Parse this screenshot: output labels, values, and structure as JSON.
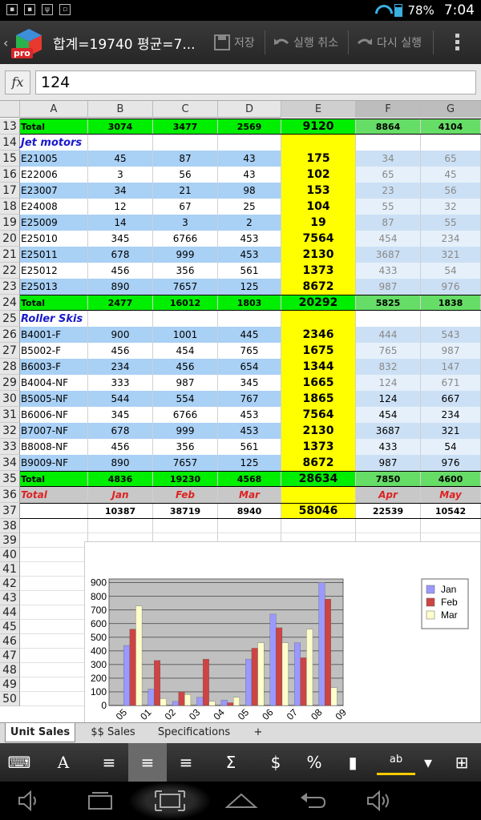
{
  "status": {
    "battery": "78%",
    "time": "7:04"
  },
  "actionbar": {
    "title": "합계=19740  평균=7...",
    "save": "저장",
    "undo": "실행 취소",
    "redo": "다시 실행",
    "logo_badge": "pro"
  },
  "formula": {
    "fx": "fx",
    "value": "124"
  },
  "columns": [
    "A",
    "B",
    "C",
    "D",
    "E",
    "F",
    "G"
  ],
  "rows": [
    {
      "n": "13",
      "cells": [
        "Total",
        "3074",
        "3477",
        "2569",
        "9120",
        "8864",
        "4104"
      ],
      "style": "total"
    },
    {
      "n": "14",
      "cells": [
        "Jet motors",
        "",
        "",
        "",
        "",
        "",
        ""
      ],
      "style": "section"
    },
    {
      "n": "15",
      "cells": [
        "E21005",
        "45",
        "87",
        "43",
        "175",
        "34",
        "65"
      ],
      "style": "blue"
    },
    {
      "n": "16",
      "cells": [
        "E22006",
        "3",
        "56",
        "43",
        "102",
        "65",
        "45"
      ],
      "style": "white"
    },
    {
      "n": "17",
      "cells": [
        "E23007",
        "34",
        "21",
        "98",
        "153",
        "23",
        "56"
      ],
      "style": "blue"
    },
    {
      "n": "18",
      "cells": [
        "E24008",
        "12",
        "67",
        "25",
        "104",
        "55",
        "32"
      ],
      "style": "white"
    },
    {
      "n": "19",
      "cells": [
        "E25009",
        "14",
        "3",
        "2",
        "19",
        "87",
        "55"
      ],
      "style": "blue"
    },
    {
      "n": "20",
      "cells": [
        "E25010",
        "345",
        "6766",
        "453",
        "7564",
        "454",
        "234"
      ],
      "style": "white"
    },
    {
      "n": "21",
      "cells": [
        "E25011",
        "678",
        "999",
        "453",
        "2130",
        "3687",
        "321"
      ],
      "style": "blue"
    },
    {
      "n": "22",
      "cells": [
        "E25012",
        "456",
        "356",
        "561",
        "1373",
        "433",
        "54"
      ],
      "style": "white"
    },
    {
      "n": "23",
      "cells": [
        "E25013",
        "890",
        "7657",
        "125",
        "8672",
        "987",
        "976"
      ],
      "style": "blue"
    },
    {
      "n": "24",
      "cells": [
        "Total",
        "2477",
        "16012",
        "1803",
        "20292",
        "5825",
        "1838"
      ],
      "style": "total"
    },
    {
      "n": "25",
      "cells": [
        "Roller Skis",
        "",
        "",
        "",
        "",
        "",
        ""
      ],
      "style": "section"
    },
    {
      "n": "26",
      "cells": [
        "B4001-F",
        "900",
        "1001",
        "445",
        "2346",
        "444",
        "543"
      ],
      "style": "blue"
    },
    {
      "n": "27",
      "cells": [
        "B5002-F",
        "456",
        "454",
        "765",
        "1675",
        "765",
        "987"
      ],
      "style": "white"
    },
    {
      "n": "28",
      "cells": [
        "B6003-F",
        "234",
        "456",
        "654",
        "1344",
        "832",
        "147"
      ],
      "style": "blue"
    },
    {
      "n": "29",
      "cells": [
        "B4004-NF",
        "333",
        "987",
        "345",
        "1665",
        "124",
        "671"
      ],
      "style": "white"
    },
    {
      "n": "30",
      "cells": [
        "B5005-NF",
        "544",
        "554",
        "767",
        "1865",
        "124",
        "667"
      ],
      "style": "blue"
    },
    {
      "n": "31",
      "cells": [
        "B6006-NF",
        "345",
        "6766",
        "453",
        "7564",
        "454",
        "234"
      ],
      "style": "white"
    },
    {
      "n": "32",
      "cells": [
        "B7007-NF",
        "678",
        "999",
        "453",
        "2130",
        "3687",
        "321"
      ],
      "style": "blue"
    },
    {
      "n": "33",
      "cells": [
        "B8008-NF",
        "456",
        "356",
        "561",
        "1373",
        "433",
        "54"
      ],
      "style": "white"
    },
    {
      "n": "34",
      "cells": [
        "B9009-NF",
        "890",
        "7657",
        "125",
        "8672",
        "987",
        "976"
      ],
      "style": "blue"
    },
    {
      "n": "35",
      "cells": [
        "Total",
        "4836",
        "19230",
        "4568",
        "28634",
        "7850",
        "4600"
      ],
      "style": "total"
    },
    {
      "n": "36",
      "cells": [
        "Total",
        "Jan",
        "Feb",
        "Mar",
        "",
        "Apr",
        "May"
      ],
      "style": "gray"
    },
    {
      "n": "37",
      "cells": [
        "",
        "10387",
        "38719",
        "8940",
        "58046",
        "22539",
        "10542"
      ],
      "style": "grand"
    },
    {
      "n": "38",
      "cells": [
        "",
        "",
        "",
        "",
        "",
        "",
        ""
      ],
      "style": "empty"
    },
    {
      "n": "39",
      "cells": [
        "",
        "",
        "",
        "",
        "",
        "",
        ""
      ],
      "style": "empty"
    },
    {
      "n": "40",
      "cells": [
        "",
        "",
        "",
        "",
        "",
        "",
        ""
      ],
      "style": "empty"
    },
    {
      "n": "41",
      "cells": [
        "",
        "",
        "",
        "",
        "",
        "",
        ""
      ],
      "style": "empty"
    },
    {
      "n": "42",
      "cells": [
        "",
        "",
        "",
        "",
        "",
        "",
        ""
      ],
      "style": "empty"
    },
    {
      "n": "43",
      "cells": [
        "",
        "",
        "",
        "",
        "",
        "",
        ""
      ],
      "style": "empty"
    },
    {
      "n": "44",
      "cells": [
        "",
        "",
        "",
        "",
        "",
        "",
        ""
      ],
      "style": "empty"
    },
    {
      "n": "45",
      "cells": [
        "",
        "",
        "",
        "",
        "",
        "",
        ""
      ],
      "style": "empty"
    },
    {
      "n": "46",
      "cells": [
        "",
        "",
        "",
        "",
        "",
        "",
        ""
      ],
      "style": "empty"
    },
    {
      "n": "47",
      "cells": [
        "",
        "",
        "",
        "",
        "",
        "",
        ""
      ],
      "style": "empty"
    },
    {
      "n": "48",
      "cells": [
        "",
        "",
        "",
        "",
        "",
        "",
        ""
      ],
      "style": "empty"
    },
    {
      "n": "49",
      "cells": [
        "",
        "",
        "",
        "",
        "",
        "",
        ""
      ],
      "style": "empty"
    },
    {
      "n": "50",
      "cells": [
        "",
        "",
        "",
        "",
        "",
        "",
        ""
      ],
      "style": "empty"
    }
  ],
  "chart_data": {
    "type": "bar",
    "categories": [
      "E21005",
      "E22006",
      "E23007",
      "E24008",
      "E25009",
      "E25010",
      "E25011",
      "E25012",
      "E25013"
    ],
    "tick_labels": [
      "05",
      "01",
      "02",
      "03",
      "04",
      "05",
      "06",
      "07",
      "08",
      "09"
    ],
    "series": [
      {
        "name": "Jan",
        "values": [
          440,
          120,
          30,
          60,
          40,
          340,
          670,
          460,
          900
        ],
        "color": "#9999ff"
      },
      {
        "name": "Feb",
        "values": [
          560,
          330,
          100,
          340,
          20,
          420,
          570,
          350,
          780
        ],
        "color": "#cc4444"
      },
      {
        "name": "Mar",
        "values": [
          730,
          50,
          80,
          30,
          60,
          460,
          460,
          560,
          130
        ],
        "color": "#ffffcc"
      }
    ],
    "yticks": [
      "900",
      "800",
      "700",
      "600",
      "500",
      "400",
      "300",
      "200",
      "100",
      "0"
    ],
    "ylim": [
      0,
      900
    ],
    "legend": "right",
    "plot_bg": "#c0c0c0"
  },
  "tabs": [
    "Unit Sales",
    "$$ Sales",
    "Specifications",
    "+"
  ],
  "toolbar": [
    "keyboard-icon",
    "font-icon",
    "align-left-icon",
    "align-center-icon",
    "align-right-icon",
    "sum-icon",
    "currency-icon",
    "percent-icon",
    "chart-icon",
    "spellcheck-icon",
    "dropdown-icon",
    "table-icon"
  ]
}
